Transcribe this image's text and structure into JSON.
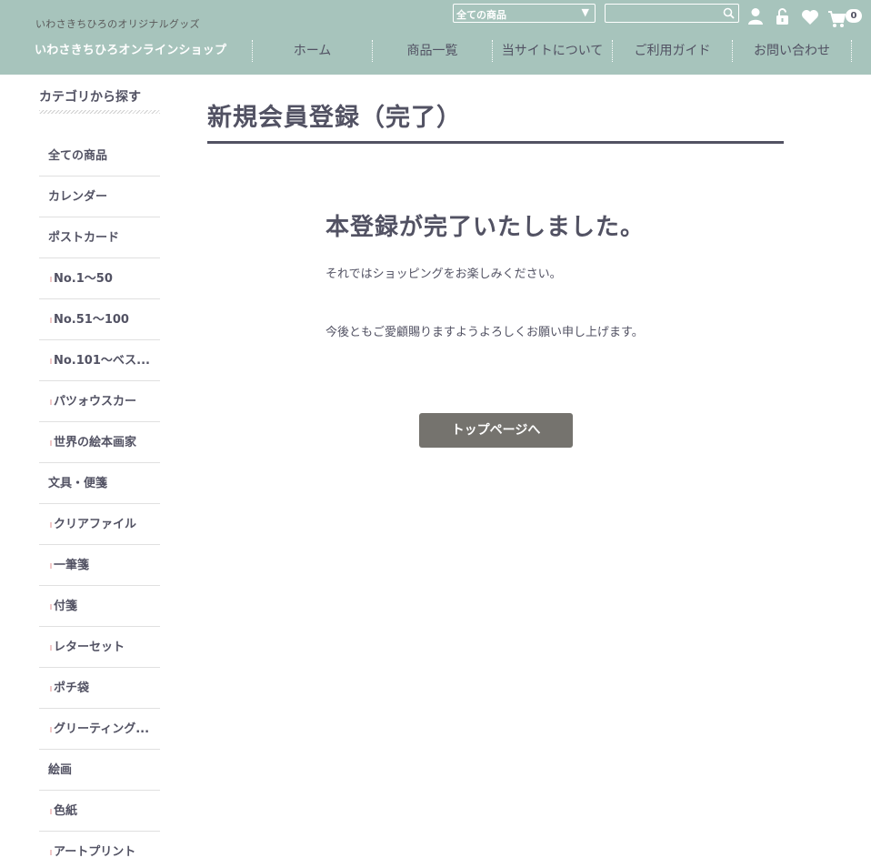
{
  "header": {
    "tagline": "いわさきちひろのオリジナルグッズ",
    "logo": "いわさきちひろオンラインショップ",
    "category_select": "全ての商品",
    "search_placeholder": "",
    "cart_count": "0",
    "nav": [
      "ホーム",
      "商品一覧",
      "当サイトについて",
      "ご利用ガイド",
      "お問い合わせ"
    ]
  },
  "sidebar": {
    "title": "カテゴリから探す",
    "items": [
      {
        "label": "全ての商品",
        "child": false
      },
      {
        "label": "カレンダー",
        "child": false
      },
      {
        "label": "ポストカード",
        "child": false
      },
      {
        "label": "No.1〜50",
        "child": true
      },
      {
        "label": "No.51〜100",
        "child": true
      },
      {
        "label": "No.101〜ベス...",
        "child": true
      },
      {
        "label": "パツォウスカー",
        "child": true
      },
      {
        "label": "世界の絵本画家",
        "child": true
      },
      {
        "label": "文具・便箋",
        "child": false
      },
      {
        "label": "クリアファイル",
        "child": true
      },
      {
        "label": "一筆箋",
        "child": true
      },
      {
        "label": "付箋",
        "child": true
      },
      {
        "label": "レターセット",
        "child": true
      },
      {
        "label": "ポチ袋",
        "child": true
      },
      {
        "label": "グリーティング...",
        "child": true
      },
      {
        "label": "絵画",
        "child": false
      },
      {
        "label": "色紙",
        "child": true
      },
      {
        "label": "アートプリント",
        "child": true
      }
    ]
  },
  "main": {
    "page_title": "新規会員登録（完了）",
    "heading": "本登録が完了いたしました。",
    "message1": "それではショッピングをお楽しみください。",
    "message2": "今後ともご愛顧賜りますようよろしくお願い申し上げます。",
    "button_label": "トップページへ"
  },
  "colors": {
    "header_bg": "#a7c4bc",
    "text": "#525263",
    "button_bg": "#75736e"
  },
  "icons": [
    "search-icon",
    "user-icon",
    "lock-icon",
    "heart-icon",
    "cart-icon",
    "dropdown-arrow-icon"
  ]
}
